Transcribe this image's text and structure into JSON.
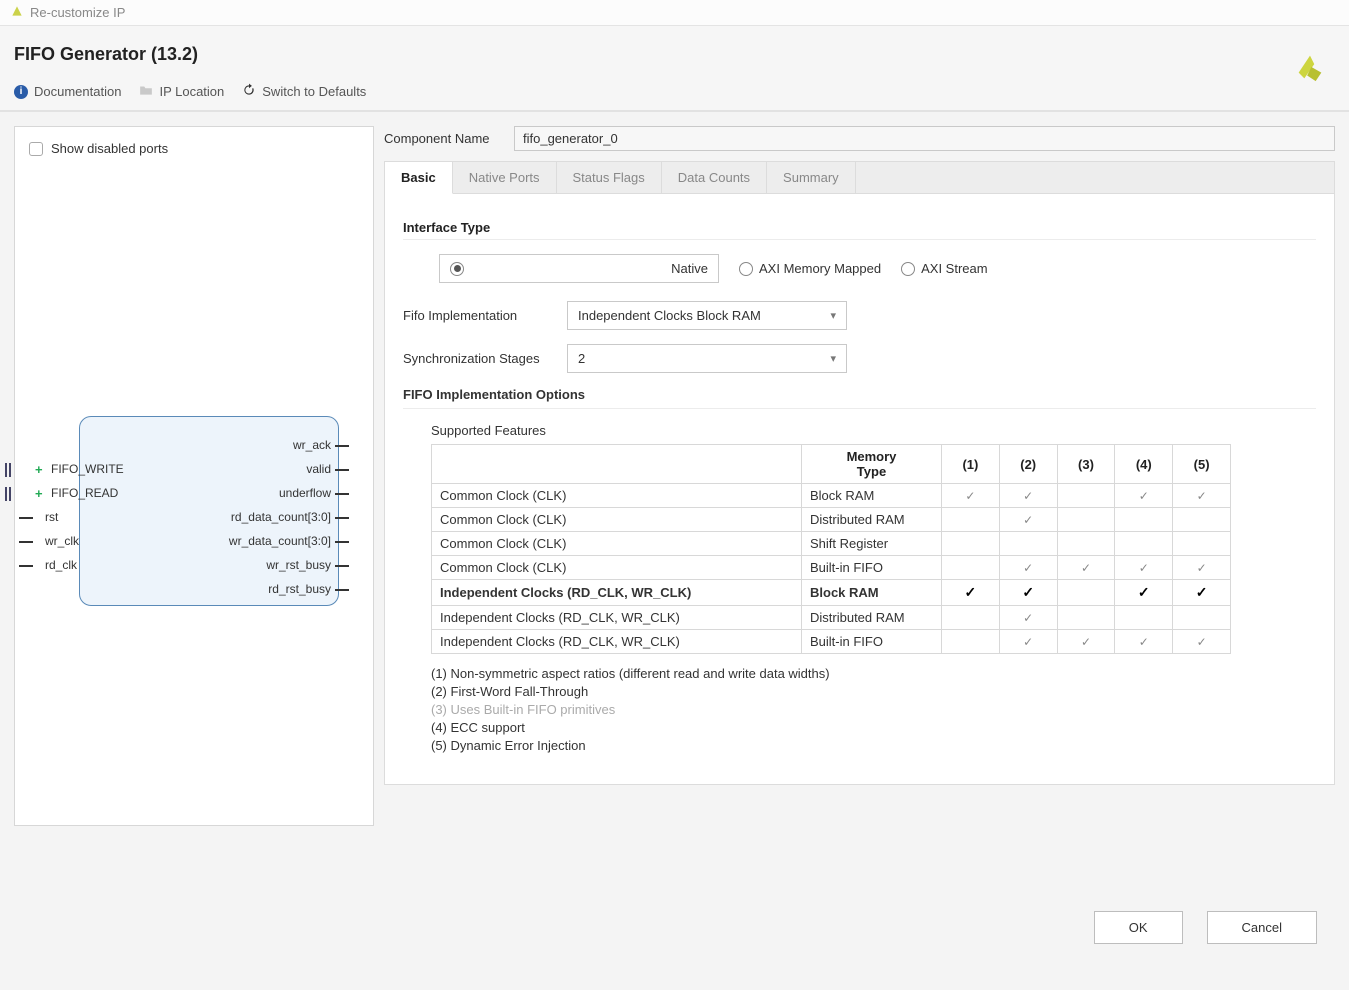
{
  "window": {
    "title": "Re-customize IP"
  },
  "header": {
    "title": "FIFO Generator (13.2)"
  },
  "toolbar": {
    "doc": "Documentation",
    "iploc": "IP Location",
    "defaults": "Switch to Defaults"
  },
  "left": {
    "show_disabled": "Show disabled ports",
    "ports_left": [
      {
        "label": "FIFO_WRITE",
        "expand": true,
        "multi": true
      },
      {
        "label": "FIFO_READ",
        "expand": true,
        "multi": true
      },
      {
        "label": "rst"
      },
      {
        "label": "wr_clk"
      },
      {
        "label": "rd_clk"
      }
    ],
    "ports_right": [
      "wr_ack",
      "valid",
      "underflow",
      "rd_data_count[3:0]",
      "wr_data_count[3:0]",
      "wr_rst_busy",
      "rd_rst_busy"
    ]
  },
  "comp": {
    "label": "Component Name",
    "value": "fifo_generator_0"
  },
  "tabs": [
    "Basic",
    "Native Ports",
    "Status Flags",
    "Data Counts",
    "Summary"
  ],
  "active_tab": 0,
  "basic": {
    "iface_title": "Interface Type",
    "radios": [
      "Native",
      "AXI Memory Mapped",
      "AXI Stream"
    ],
    "radio_sel": 0,
    "fifo_impl_label": "Fifo Implementation",
    "fifo_impl_value": "Independent Clocks Block RAM",
    "sync_label": "Synchronization Stages",
    "sync_value": "2",
    "options_title": "FIFO Implementation Options",
    "supported": "Supported Features",
    "headers": [
      "",
      "Memory Type",
      "(1)",
      "(2)",
      "(3)",
      "(4)",
      "(5)"
    ],
    "rows": [
      {
        "c0": "Common Clock (CLK)",
        "c1": "Block RAM",
        "f": [
          1,
          1,
          0,
          1,
          1
        ],
        "bold": false
      },
      {
        "c0": "Common Clock (CLK)",
        "c1": "Distributed RAM",
        "f": [
          0,
          1,
          0,
          0,
          0
        ],
        "bold": false
      },
      {
        "c0": "Common Clock (CLK)",
        "c1": "Shift Register",
        "f": [
          0,
          0,
          0,
          0,
          0
        ],
        "bold": false
      },
      {
        "c0": "Common Clock (CLK)",
        "c1": "Built-in FIFO",
        "f": [
          0,
          1,
          1,
          1,
          1
        ],
        "bold": false
      },
      {
        "c0": "Independent Clocks (RD_CLK, WR_CLK)",
        "c1": "Block RAM",
        "f": [
          1,
          1,
          0,
          1,
          1
        ],
        "bold": true
      },
      {
        "c0": "Independent Clocks (RD_CLK, WR_CLK)",
        "c1": "Distributed RAM",
        "f": [
          0,
          1,
          0,
          0,
          0
        ],
        "bold": false
      },
      {
        "c0": "Independent Clocks (RD_CLK, WR_CLK)",
        "c1": "Built-in FIFO",
        "f": [
          0,
          1,
          1,
          1,
          1
        ],
        "bold": false
      }
    ],
    "notes": [
      {
        "t": "(1) Non-symmetric aspect ratios (different read and write data widths)",
        "muted": false
      },
      {
        "t": "(2) First-Word Fall-Through",
        "muted": false
      },
      {
        "t": "(3) Uses Built-in FIFO primitives",
        "muted": true
      },
      {
        "t": "(4) ECC support",
        "muted": false
      },
      {
        "t": "(5) Dynamic Error Injection",
        "muted": false
      }
    ]
  },
  "footer": {
    "ok": "OK",
    "cancel": "Cancel"
  }
}
